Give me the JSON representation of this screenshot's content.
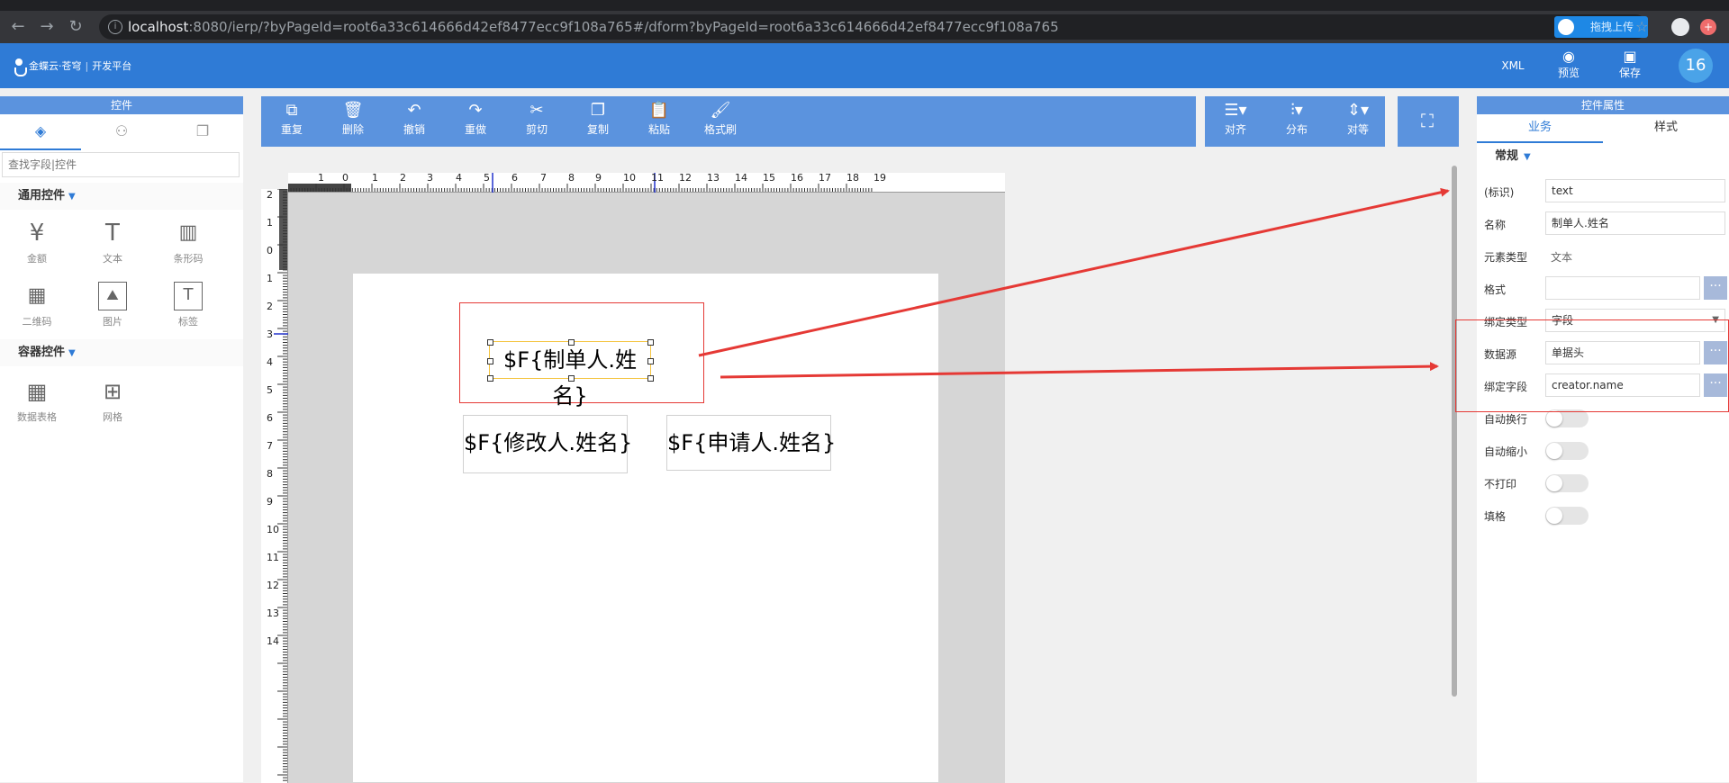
{
  "browser": {
    "url_host": "localhost",
    "url_rest": ":8080/ierp/?byPageId=root6a33c614666d42ef8477ecc9f108a765#/dform?byPageId=root6a33c614666d42ef8477ecc9f108a765",
    "upload_ext_label": "拖拽上传"
  },
  "header": {
    "logo_brand": "金蝶云·苍穹",
    "logo_sub": "开发平台",
    "xml_label": "XML",
    "preview_label": "预览",
    "save_label": "保存",
    "avatar_text": "16",
    "bg_color": "#2f7bd6"
  },
  "left_panel": {
    "title": "控件",
    "search_placeholder": "查找字段|控件",
    "common_section": "通用控件",
    "container_section": "容器控件",
    "common_controls": [
      {
        "label": "金额",
        "icon": "yen-icon"
      },
      {
        "label": "文本",
        "icon": "text-icon"
      },
      {
        "label": "条形码",
        "icon": "barcode-icon"
      },
      {
        "label": "二维码",
        "icon": "qrcode-icon"
      },
      {
        "label": "图片",
        "icon": "image-icon"
      },
      {
        "label": "标签",
        "icon": "label-icon"
      }
    ],
    "container_controls": [
      {
        "label": "数据表格",
        "icon": "table-icon"
      },
      {
        "label": "网格",
        "icon": "grid-icon"
      }
    ]
  },
  "toolbar": {
    "buttons": [
      "重复",
      "删除",
      "撤销",
      "重做",
      "剪切",
      "复制",
      "粘贴",
      "格式刷"
    ],
    "align_buttons": [
      "对齐",
      "分布",
      "对等"
    ]
  },
  "canvas": {
    "hruler_labels": [
      "1",
      "0",
      "1",
      "2",
      "3",
      "4",
      "5",
      "6",
      "7",
      "8",
      "9",
      "10",
      "11",
      "12",
      "13",
      "14",
      "15",
      "16",
      "17",
      "18",
      "19"
    ],
    "vruler_labels": [
      "2",
      "1",
      "0",
      "1",
      "2",
      "3",
      "4",
      "5",
      "6",
      "7",
      "8",
      "9",
      "10",
      "11",
      "12",
      "13",
      "14"
    ],
    "field_creator": "$F{制单人.姓名}",
    "field_modifier": "$F{修改人.姓名}",
    "field_applicant": "$F{申请人.姓名}"
  },
  "right_panel": {
    "title": "控件属性",
    "tab_business": "业务",
    "tab_style": "样式",
    "group": "常规",
    "props": {
      "id_label": "(标识)",
      "id_value": "text",
      "name_label": "名称",
      "name_value": "制单人.姓名",
      "type_label": "元素类型",
      "type_value": "文本",
      "format_label": "格式",
      "format_value": "",
      "bind_type_label": "绑定类型",
      "bind_type_value": "字段",
      "datasource_label": "数据源",
      "datasource_value": "单据头",
      "bind_field_label": "绑定字段",
      "bind_field_value": "creator.name",
      "auto_wrap_label": "自动换行",
      "auto_shrink_label": "自动缩小",
      "no_print_label": "不打印",
      "fill_label": "填格"
    },
    "ellipsis": "···"
  },
  "annotation_color": "#e53935"
}
